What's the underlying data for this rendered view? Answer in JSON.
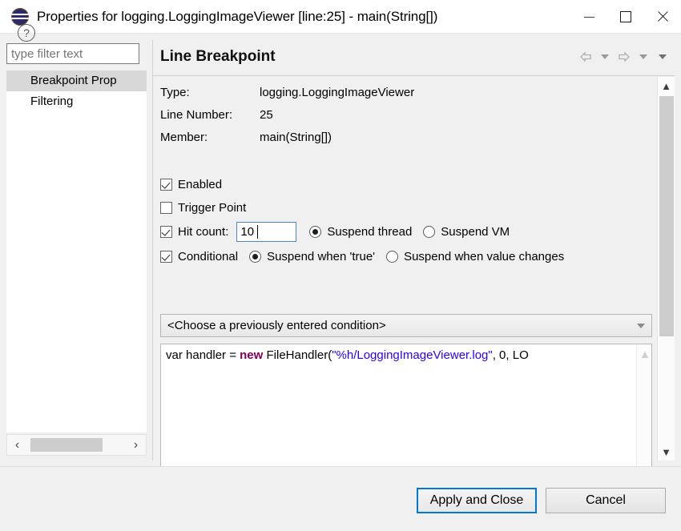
{
  "window": {
    "title": "Properties for logging.LoggingImageViewer [line:25] - main(String[])",
    "icon": "eclipse-icon",
    "controls": {
      "minimize": "minimize-icon",
      "maximize": "maximize-icon",
      "close": "close-icon"
    }
  },
  "sidebar": {
    "filter": {
      "placeholder": "type filter text",
      "value": ""
    },
    "items": [
      {
        "label": "Breakpoint Prop",
        "selected": true
      },
      {
        "label": "Filtering",
        "selected": false
      }
    ],
    "hscroll": {
      "left_arrow": "‹",
      "right_arrow": "›"
    }
  },
  "content": {
    "title": "Line Breakpoint",
    "header_actions": [
      {
        "name": "back-arrow-icon",
        "glyph": "back"
      },
      {
        "name": "back-dropdown-icon",
        "glyph": "chevron"
      },
      {
        "name": "forward-arrow-icon",
        "glyph": "forward"
      },
      {
        "name": "forward-dropdown-icon",
        "glyph": "chevron"
      },
      {
        "name": "menu-dropdown-icon",
        "glyph": "chevron-dark"
      }
    ],
    "info": [
      {
        "label": "Type:",
        "value": "logging.LoggingImageViewer"
      },
      {
        "label": "Line Number:",
        "value": "25"
      },
      {
        "label": "Member:",
        "value": "main(String[])"
      }
    ],
    "options": {
      "enabled": {
        "label": "Enabled",
        "checked": true
      },
      "trigger_point": {
        "label": "Trigger Point",
        "checked": false
      },
      "hit_count": {
        "label": "Hit count:",
        "checked": true,
        "value": "10"
      },
      "suspend_policy": {
        "thread": {
          "label": "Suspend thread",
          "selected": true
        },
        "vm": {
          "label": "Suspend VM",
          "selected": false
        }
      },
      "conditional": {
        "label": "Conditional",
        "checked": true
      },
      "condition_policy": {
        "when_true": {
          "label": "Suspend when 'true'",
          "selected": true
        },
        "value_changes": {
          "label": "Suspend when value changes",
          "selected": false
        }
      }
    },
    "condition_combo": {
      "value": "<Choose a previously entered condition>",
      "chevron": "chevron-down-icon"
    },
    "code_editor": {
      "line_prefix": "var handler = ",
      "keyword": "new",
      "after_keyword": " FileHandler(",
      "string_literal": "\"%h/LoggingImageViewer.log\"",
      "line_suffix": ", 0, LO",
      "keyword_color": "#7f0055",
      "string_color": "#2a00ff"
    }
  },
  "footer": {
    "help_label": "?",
    "apply_close_label": "Apply and Close",
    "cancel_label": "Cancel",
    "focus_color": "#0078d7"
  }
}
